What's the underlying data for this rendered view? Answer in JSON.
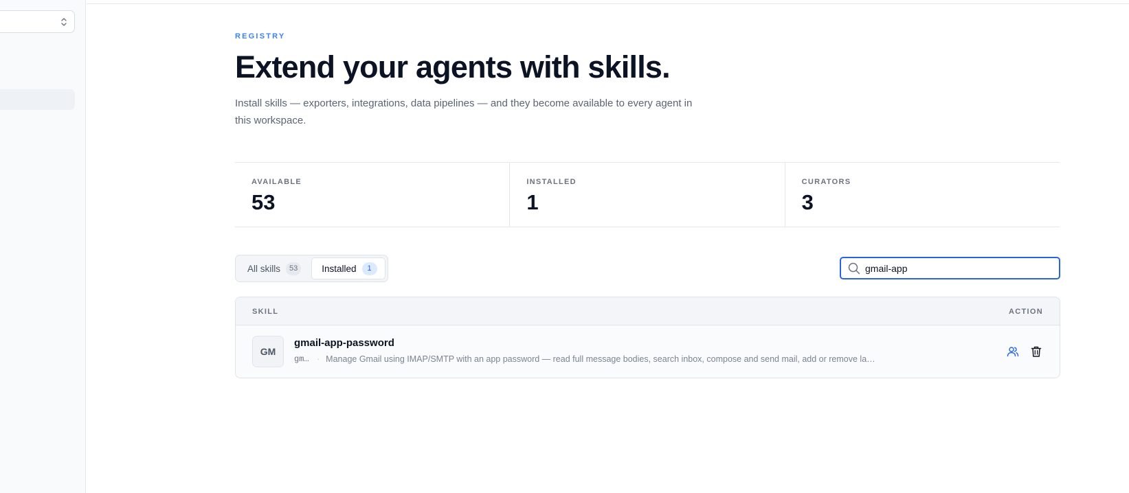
{
  "registry": {
    "eyebrow": "REGISTRY",
    "title": "Extend your agents with skills.",
    "description": "Install skills — exporters, integrations, data pipelines — and they become available to every agent in this workspace."
  },
  "stats": [
    {
      "label": "AVAILABLE",
      "value": "53"
    },
    {
      "label": "INSTALLED",
      "value": "1"
    },
    {
      "label": "CURATORS",
      "value": "3"
    }
  ],
  "tabs": [
    {
      "label": "All skills",
      "count": "53",
      "active": false
    },
    {
      "label": "Installed",
      "count": "1",
      "active": true
    }
  ],
  "search": {
    "value": "gmail-app",
    "icon": "search-icon"
  },
  "table": {
    "headers": {
      "skill": "SKILL",
      "action": "ACTION"
    },
    "rows": [
      {
        "initials": "GM",
        "name": "gmail-app-password",
        "slug": "gm…",
        "separator": "·",
        "summary": "Manage Gmail using IMAP/SMTP with an app password — read full message bodies, search inbox, compose and send mail, add or remove la…",
        "actions": [
          "users-icon",
          "trash-icon"
        ]
      }
    ]
  },
  "colors": {
    "accent": "#2563eb",
    "eyebrow": "#3b82f6",
    "heading": "#0b1324"
  }
}
